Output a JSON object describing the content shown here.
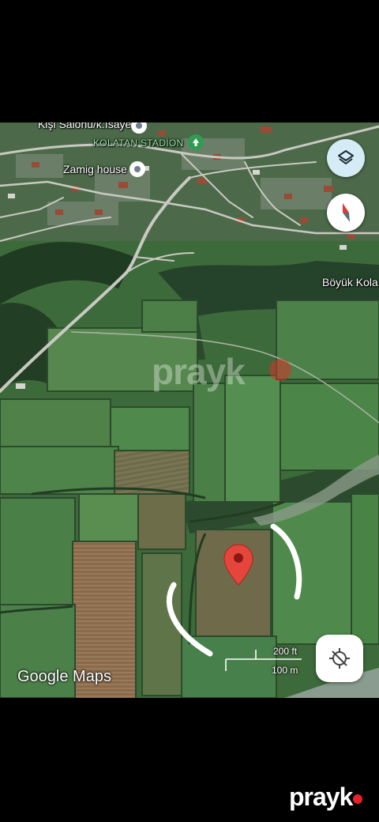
{
  "map": {
    "places": {
      "top_cut": "Kişi Salonu/k.İsayev",
      "stadium": "KOLATAN STADİON",
      "house": "Zamig house",
      "village": "Böyük Kola"
    },
    "attribution": "Google Maps",
    "scale": {
      "imperial": "200 ft",
      "metric": "100 m"
    },
    "marker_color": "#e5453b"
  },
  "controls": {
    "layers_icon": "layers-icon",
    "compass_icon": "compass-icon",
    "locate_icon": "location-disabled-icon"
  },
  "watermark": {
    "text": "prayk",
    "accent": "#e8202a"
  }
}
